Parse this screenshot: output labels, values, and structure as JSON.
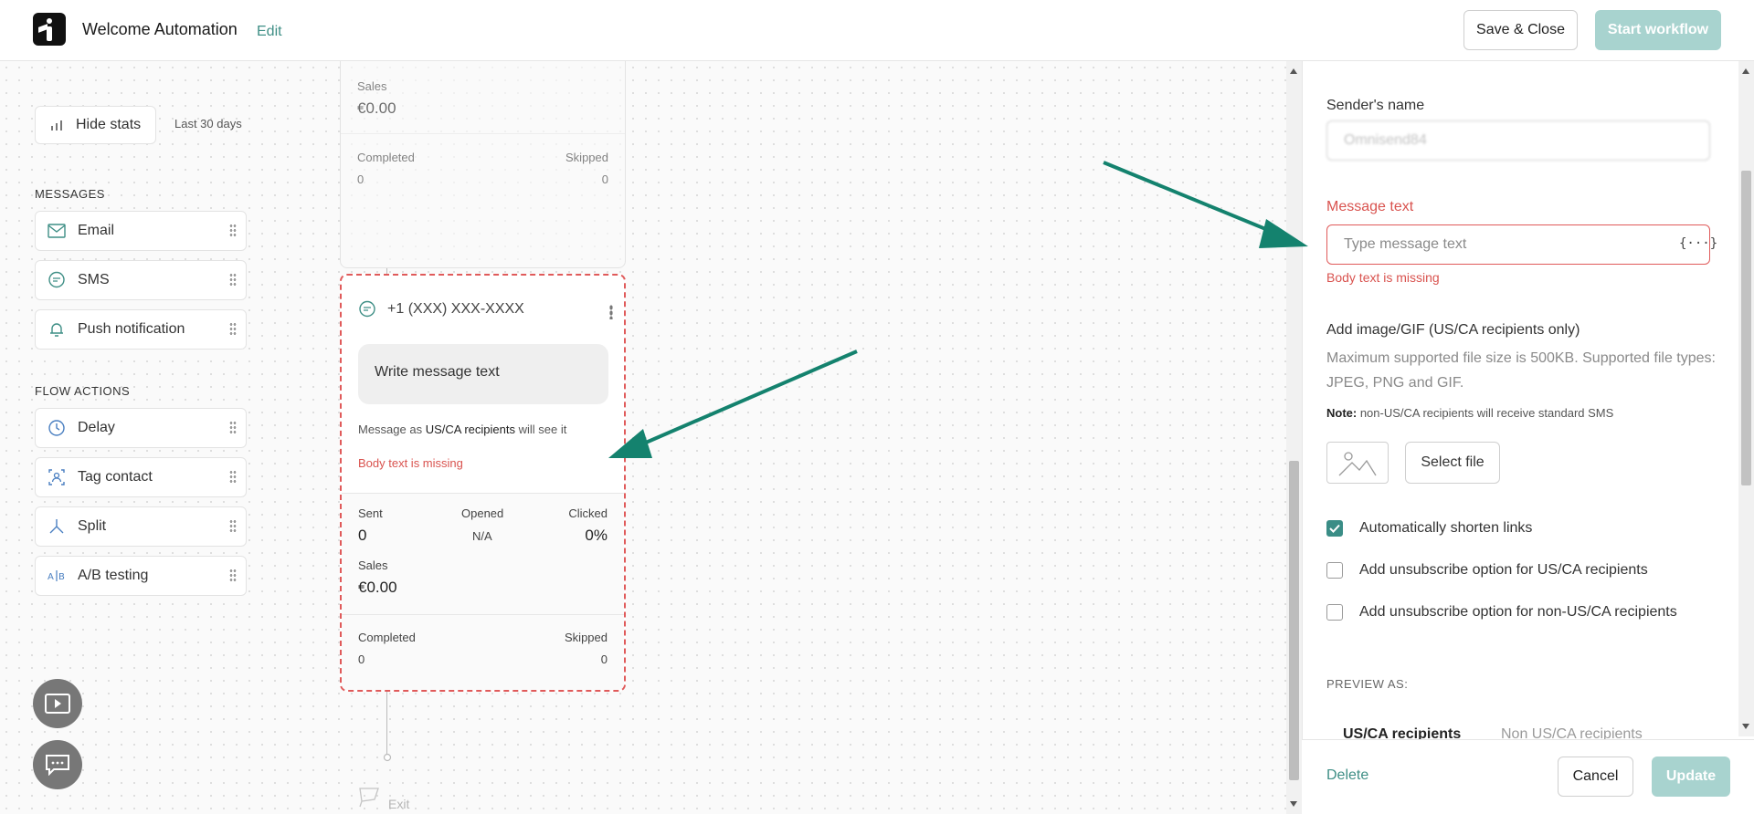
{
  "header": {
    "title": "Welcome Automation",
    "edit_label": "Edit",
    "save_close_label": "Save & Close",
    "start_workflow_label": "Start workflow"
  },
  "palette": {
    "hide_stats_label": "Hide stats",
    "period_label": "Last 30 days",
    "messages_title": "MESSAGES",
    "messages": [
      {
        "label": "Email",
        "icon": "mail-icon"
      },
      {
        "label": "SMS",
        "icon": "chat-bubble-icon"
      },
      {
        "label": "Push notification",
        "icon": "bell-icon"
      }
    ],
    "flow_title": "FLOW ACTIONS",
    "flow_actions": [
      {
        "label": "Delay",
        "icon": "clock-icon"
      },
      {
        "label": "Tag contact",
        "icon": "tag-person-icon"
      },
      {
        "label": "Split",
        "icon": "split-icon"
      },
      {
        "label": "A/B testing",
        "icon": "ab-icon"
      }
    ]
  },
  "top_node": {
    "sales_label": "Sales",
    "sales_value": "€0.00",
    "completed_label": "Completed",
    "completed_value": "0",
    "skipped_label": "Skipped",
    "skipped_value": "0"
  },
  "sms_node": {
    "phone": "+1 (XXX) XXX-XXXX",
    "bubble_text": "Write message text",
    "message_as_prefix": "Message as ",
    "message_as_bold": "US/CA recipients",
    "message_as_suffix": " will see it",
    "error": "Body text is missing",
    "sent_label": "Sent",
    "sent_value": "0",
    "opened_label": "Opened",
    "opened_value": "N/A",
    "clicked_label": "Clicked",
    "clicked_value": "0%",
    "sales_label": "Sales",
    "sales_value": "€0.00",
    "completed_label": "Completed",
    "completed_value": "0",
    "skipped_label": "Skipped",
    "skipped_value": "0"
  },
  "exit_label": "Exit",
  "panel": {
    "sender_label": "Sender's name",
    "sender_value": "Omnisend84",
    "message_label": "Message text",
    "message_placeholder": "Type message text",
    "variable_glyph": "{···}",
    "message_error": "Body text is missing",
    "image_label": "Add image/GIF (US/CA recipients only)",
    "image_desc": "Maximum supported file size is 500KB. Supported file types: JPEG, PNG and GIF.",
    "note_bold": "Note:",
    "note_text": " non-US/CA recipients will receive standard SMS",
    "select_file_label": "Select file",
    "checkboxes": [
      {
        "label": "Automatically shorten links",
        "checked": true
      },
      {
        "label": "Add unsubscribe option for US/CA recipients",
        "checked": false
      },
      {
        "label": "Add unsubscribe option for non-US/CA recipients",
        "checked": false
      }
    ],
    "preview_as_label": "PREVIEW AS:",
    "tabs": [
      "US/CA recipients",
      "Non US/CA recipients"
    ],
    "delete_label": "Delete",
    "cancel_label": "Cancel",
    "update_label": "Update"
  },
  "colors": {
    "accent": "#3f8f86",
    "accent_disabled": "#a8d3cf",
    "error": "#d9534f",
    "arrow": "#14826e"
  }
}
